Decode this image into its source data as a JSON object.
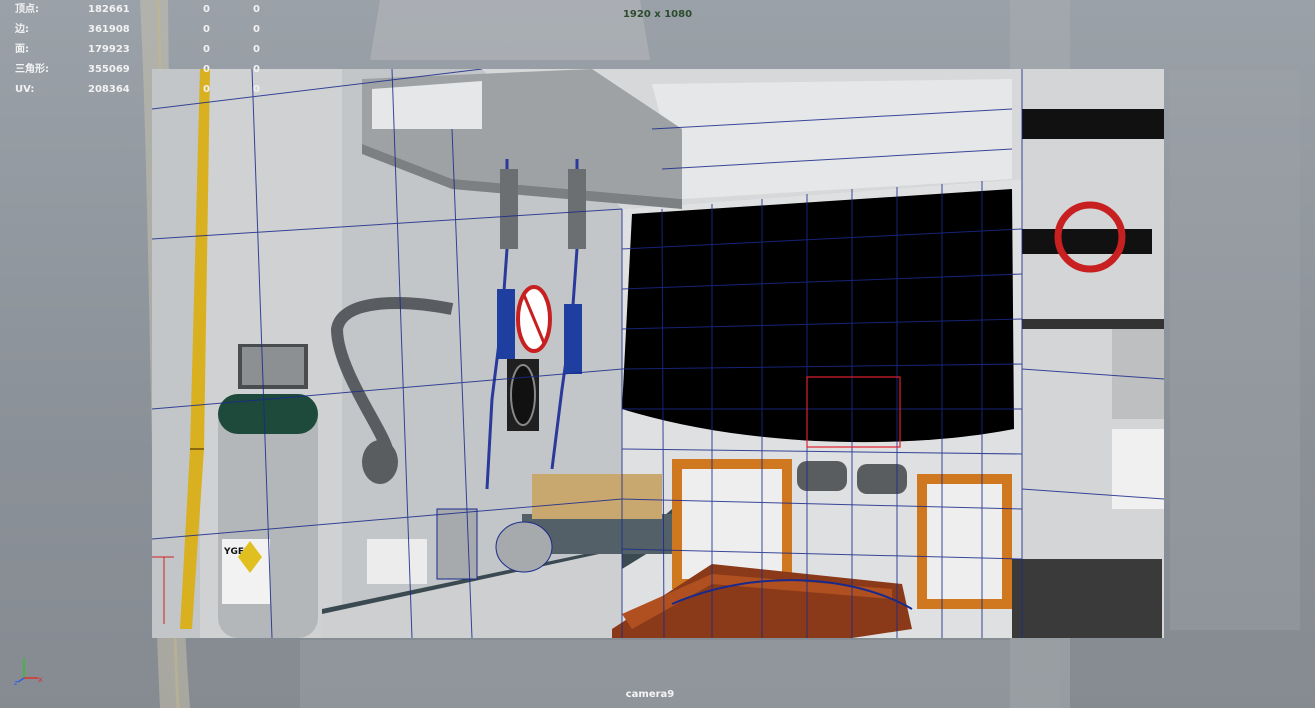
{
  "hud": {
    "stats": [
      {
        "label": "顶点:",
        "v1": "182661",
        "v2": "0",
        "v3": "0"
      },
      {
        "label": "边:",
        "v1": "361908",
        "v2": "0",
        "v3": "0"
      },
      {
        "label": "面:",
        "v1": "179923",
        "v2": "0",
        "v3": "0"
      },
      {
        "label": "三角形:",
        "v1": "355069",
        "v2": "0",
        "v3": "0"
      },
      {
        "label": "UV:",
        "v1": "208364",
        "v2": "0",
        "v3": "0"
      }
    ],
    "resolution": "1920 x 1080",
    "camera": "camera9"
  },
  "scene": {
    "oxygen_label": "YGEN",
    "colors": {
      "wireframe": "#1a2a8c",
      "selection": "#e02030",
      "rail": "#d8b020",
      "cabinet_trim": "#d07820",
      "stretcher": "#8a3a18"
    }
  },
  "axis_gizmo": {
    "x_label": "x",
    "y_label": "y",
    "z_label": "z"
  }
}
